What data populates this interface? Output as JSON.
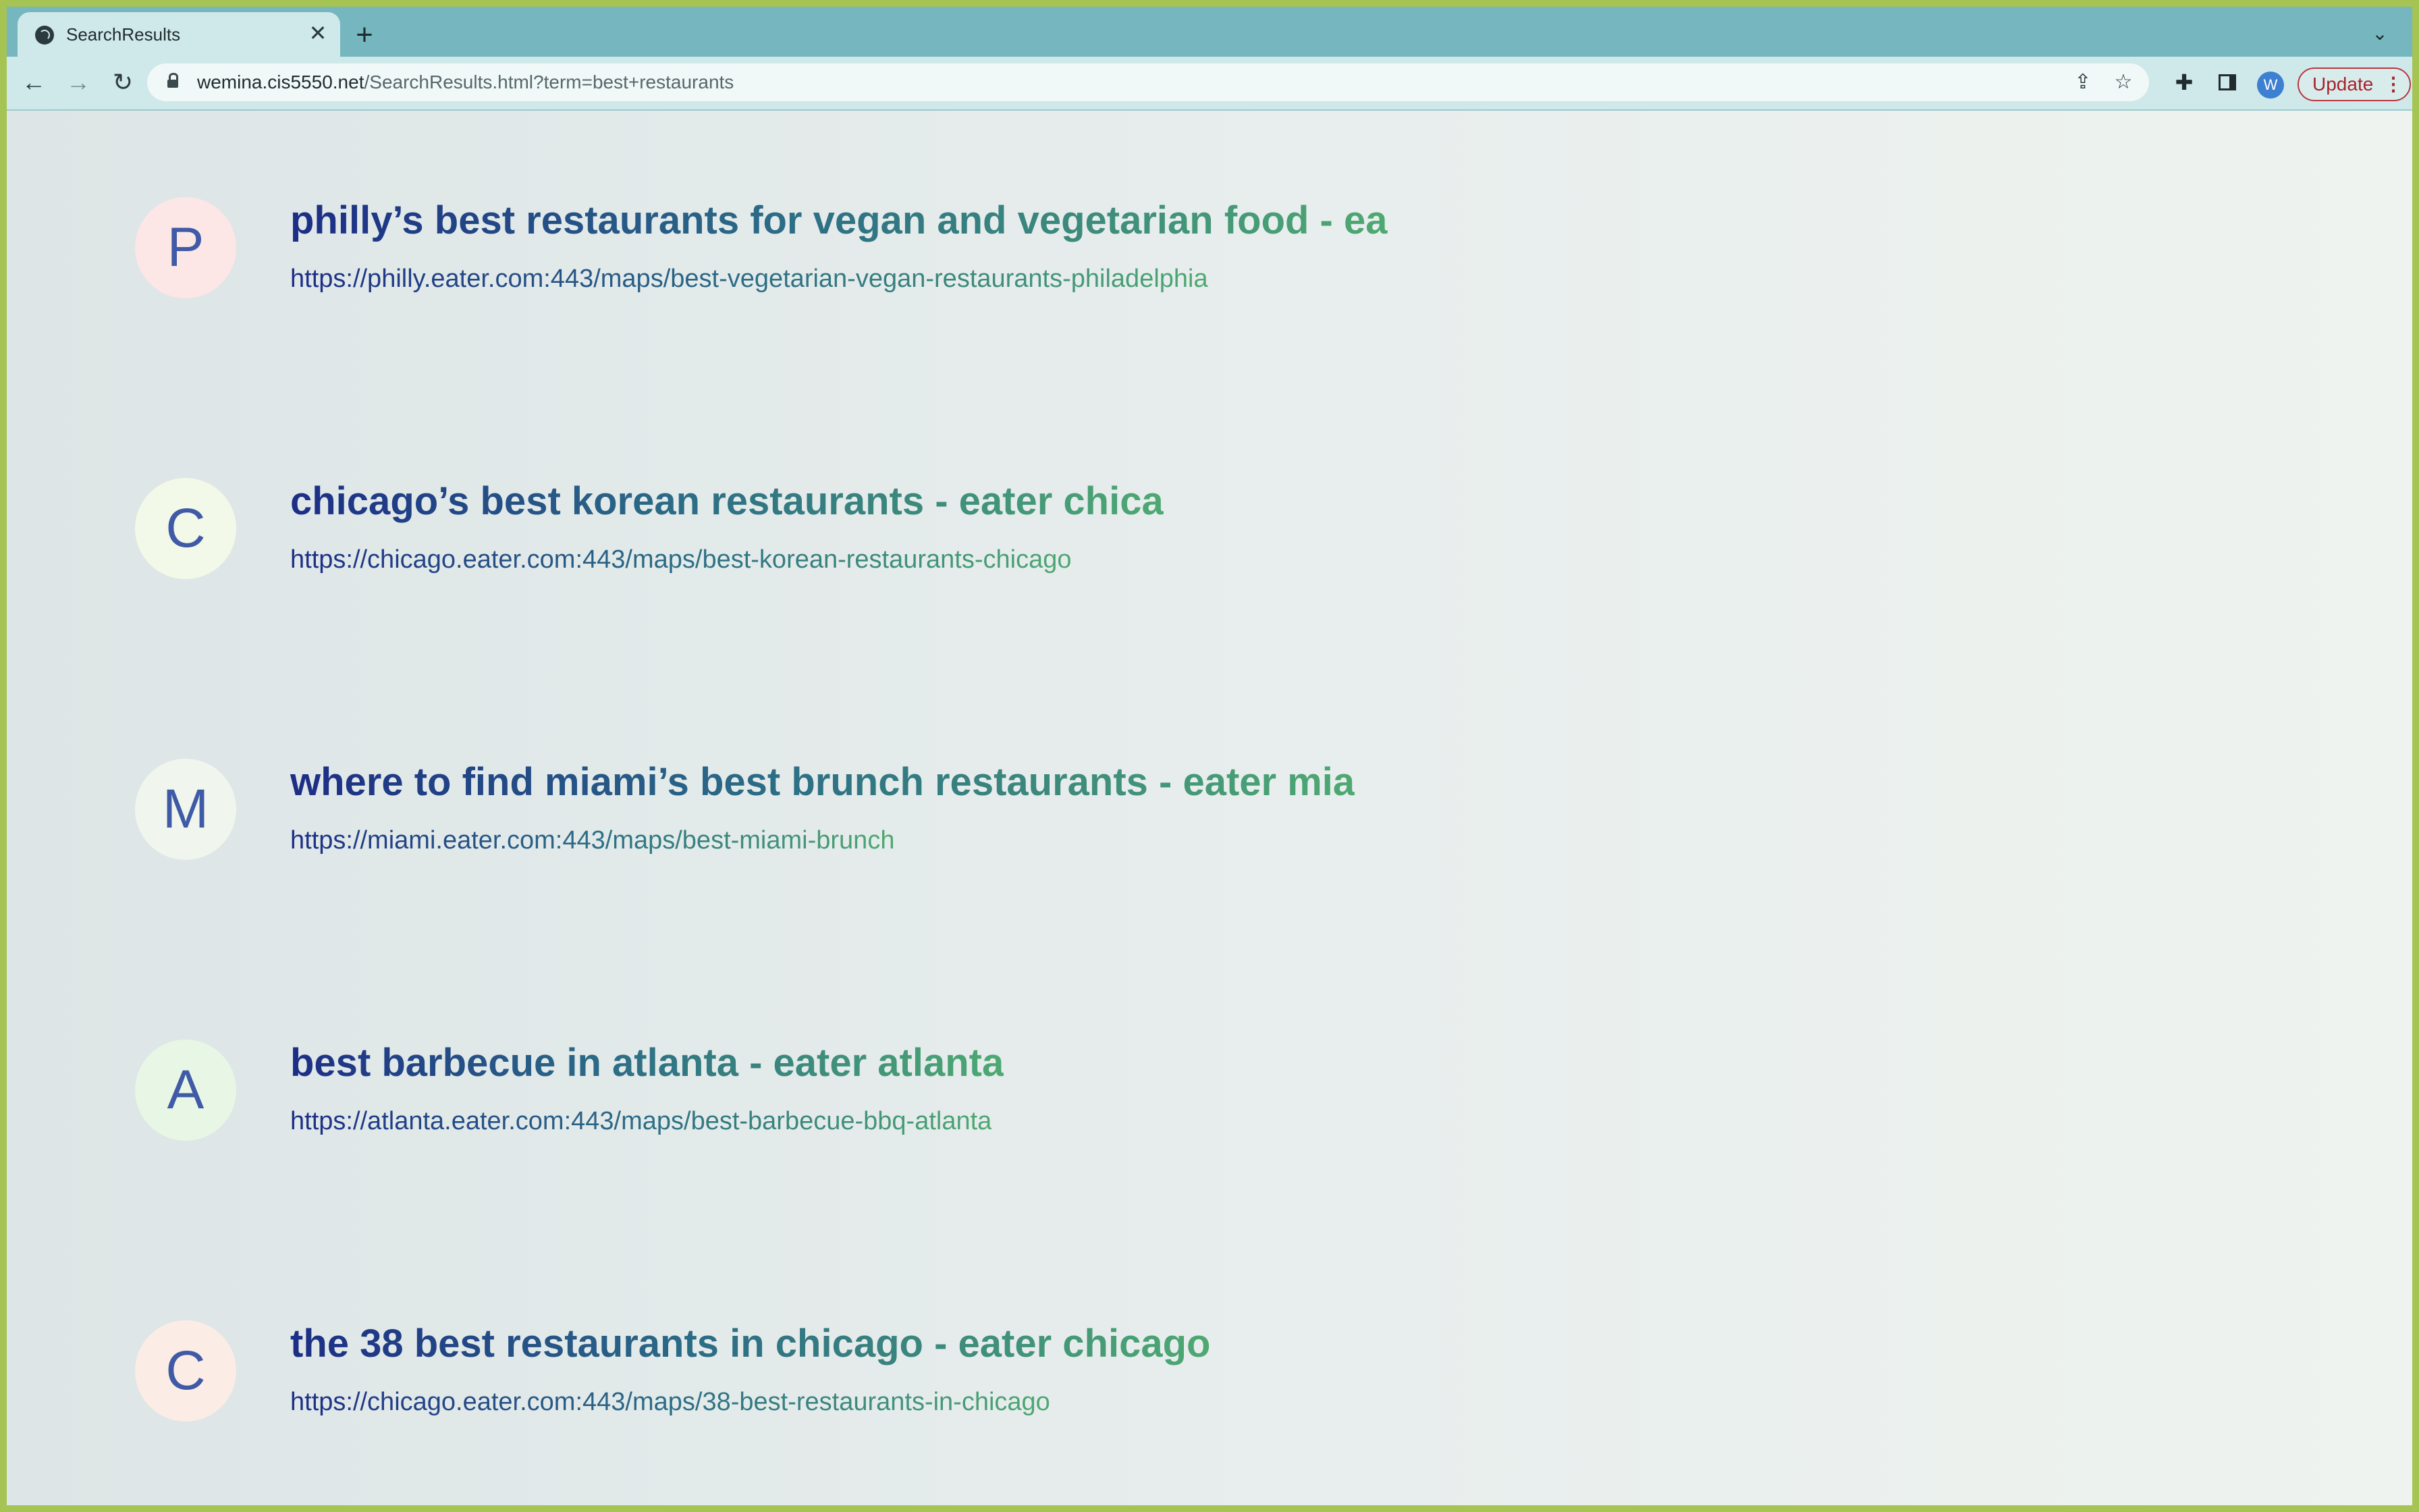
{
  "browser": {
    "tab_title": "SearchResults",
    "tab_close": "✕",
    "new_tab": "+",
    "tab_list": "⌄",
    "url_host": "wemina.cis5550.net",
    "url_path": "/SearchResults.html?term=best+restaurants",
    "avatar_letter": "W",
    "update_label": "Update",
    "menu_dots": "⋮"
  },
  "results": [
    {
      "letter": "P",
      "badge_color": "#fde6e6",
      "title": "philly’s best restaurants for vegan and vegetarian food - ea",
      "url": "https://philly.eater.com:443/maps/best-vegetarian-vegan-restaurants-philadelphia"
    },
    {
      "letter": "C",
      "badge_color": "#f2f9e8",
      "title": "chicago’s best korean restaurants - eater chica",
      "url": "https://chicago.eater.com:443/maps/best-korean-restaurants-chicago"
    },
    {
      "letter": "M",
      "badge_color": "#f0f6ee",
      "title": "where to find miami’s best brunch restaurants - eater mia",
      "url": "https://miami.eater.com:443/maps/best-miami-brunch"
    },
    {
      "letter": "A",
      "badge_color": "#e8f6e6",
      "title": "best barbecue in atlanta - eater atlanta",
      "url": "https://atlanta.eater.com:443/maps/best-barbecue-bbq-atlanta"
    },
    {
      "letter": "C",
      "badge_color": "#fcece6",
      "title": "the 38 best restaurants in chicago - eater chicago",
      "url": "https://chicago.eater.com:443/maps/38-best-restaurants-in-chicago"
    }
  ]
}
